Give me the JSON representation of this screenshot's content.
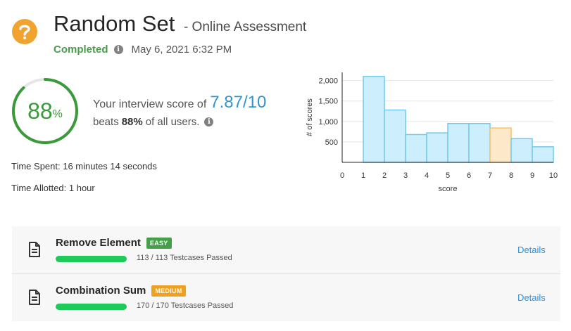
{
  "header": {
    "title": "Random Set",
    "subtitle": "- Online Assessment",
    "status": "Completed",
    "date": "May 6, 2021 6:32 PM",
    "icon": "question-mark-icon",
    "icon_color": "#f0a32f"
  },
  "score": {
    "percent": 88,
    "percent_text": "88",
    "percent_symbol": "%",
    "label": "Your interview score of",
    "value": "7.87/10",
    "beats_prefix": "beats",
    "beats_value": "88%",
    "beats_suffix": "of all users.",
    "ring_color": "#3a9a3a",
    "value_color": "#2e95d3"
  },
  "time": {
    "spent": "Time Spent: 16 minutes 14 seconds",
    "allotted": "Time Allotted: 1 hour"
  },
  "chart_data": {
    "type": "bar",
    "title": "",
    "xlabel": "score",
    "ylabel": "# of scores",
    "xlim": [
      0,
      10
    ],
    "ylim": [
      0,
      2200
    ],
    "xticks": [
      0,
      1,
      2,
      3,
      4,
      5,
      6,
      7,
      8,
      9,
      10
    ],
    "yticks": [
      500,
      1000,
      1500,
      2000
    ],
    "ytick_labels": [
      "500",
      "1,000",
      "1,500",
      "2,000"
    ],
    "bins": [
      {
        "x0": 1,
        "x1": 2,
        "value": 2100
      },
      {
        "x0": 2,
        "x1": 3,
        "value": 1280
      },
      {
        "x0": 3,
        "x1": 4,
        "value": 680
      },
      {
        "x0": 4,
        "x1": 5,
        "value": 720
      },
      {
        "x0": 5,
        "x1": 6,
        "value": 950
      },
      {
        "x0": 6,
        "x1": 7,
        "value": 950
      },
      {
        "x0": 7,
        "x1": 8,
        "value": 840,
        "highlight": true
      },
      {
        "x0": 8,
        "x1": 9,
        "value": 580
      },
      {
        "x0": 9,
        "x1": 10,
        "value": 380
      }
    ],
    "bar_fill": "#cdeefc",
    "bar_stroke": "#6fcbeb",
    "highlight_fill": "#fde9c9",
    "highlight_stroke": "#f5c26b",
    "grid": true
  },
  "problems": [
    {
      "name": "Remove Element",
      "difficulty": "EASY",
      "difficulty_color": "#43a047",
      "passed_text": "113 / 113 Testcases Passed",
      "progress": 1.0,
      "details_label": "Details"
    },
    {
      "name": "Combination Sum",
      "difficulty": "MEDIUM",
      "difficulty_color": "#f0a020",
      "passed_text": "170 / 170 Testcases Passed",
      "progress": 1.0,
      "details_label": "Details"
    }
  ]
}
